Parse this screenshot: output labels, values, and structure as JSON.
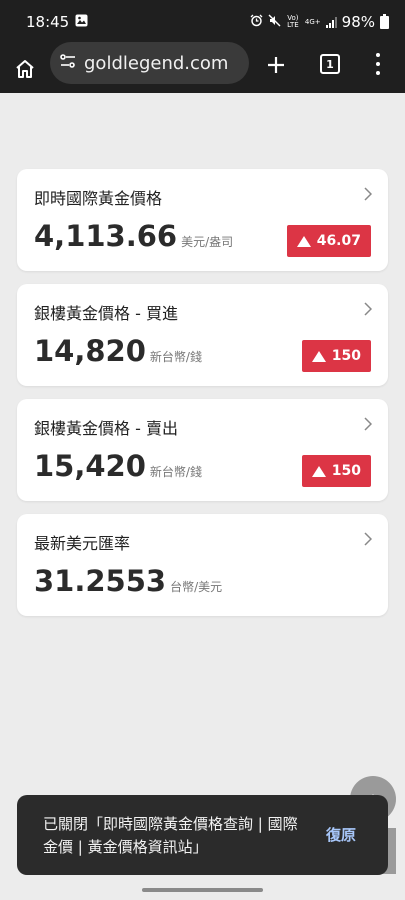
{
  "status_bar": {
    "time": "18:45",
    "network": "4G+",
    "volte": "Vo) LTE",
    "battery": "98%"
  },
  "toolbar": {
    "url": "goldlegend.com",
    "tab_count": "1"
  },
  "cards": [
    {
      "title": "即時國際黃金價格",
      "value": "4,113.66",
      "unit": "美元/盎司",
      "change": "46.07"
    },
    {
      "title": "銀樓黃金價格 - 買進",
      "value": "14,820",
      "unit": "新台幣/錢",
      "change": "150"
    },
    {
      "title": "銀樓黃金價格 - 賣出",
      "value": "15,420",
      "unit": "新台幣/錢",
      "change": "150"
    },
    {
      "title": "最新美元匯率",
      "value": "31.2553",
      "unit": "台幣/美元"
    }
  ],
  "toast": {
    "message": "已關閉「即時國際黃金價格查詢 | 國際金價 | 黃金價格資訊站」",
    "action": "復原"
  },
  "colors": {
    "badge_red": "#dc3545",
    "toast_action": "#a8c7fa",
    "toolbar_bg": "#1f1f1f"
  }
}
